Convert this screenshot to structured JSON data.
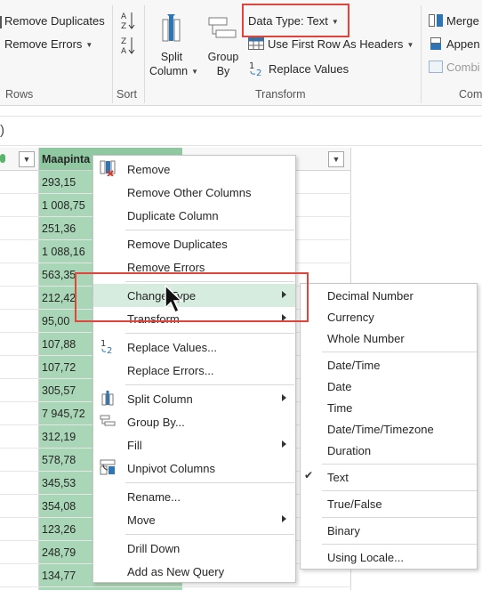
{
  "ribbon": {
    "remove_duplicates": "Remove Duplicates",
    "remove_errors": "Remove Errors",
    "rows_label": "Rows",
    "sort_label": "Sort",
    "split_column": [
      "Split",
      "Column"
    ],
    "group_by": [
      "Group",
      "By"
    ],
    "data_type": "Data Type: Text",
    "use_first_row": "Use First Row As Headers",
    "replace_values": "Replace Values",
    "transform_label": "Transform",
    "merge": "Merge",
    "append": "Appen",
    "combine": "Combi",
    "combine_label": "Com"
  },
  "formula": {
    "paren": ")"
  },
  "table": {
    "column_header": "Maapinta",
    "values": [
      "293,15",
      "1 008,75",
      "251,36",
      "1 088,16",
      "563,35",
      "212,42",
      "95,00",
      "107,88",
      "107,72",
      "305,57",
      "7 945,72",
      "312,19",
      "578,78",
      "345,53",
      "354,08",
      "123,26",
      "248,79",
      "134,77"
    ]
  },
  "context_menu": {
    "items": [
      {
        "label": "Remove",
        "icon": "remove-column-icon"
      },
      {
        "label": "Remove Other Columns"
      },
      {
        "label": "Duplicate Column"
      },
      {
        "label": "Remove Duplicates"
      },
      {
        "label": "Remove Errors"
      },
      {
        "label": "Change Type",
        "submenu": true
      },
      {
        "label": "Transform",
        "submenu": true
      },
      {
        "label": "Replace Values...",
        "icon": "replace-values-icon"
      },
      {
        "label": "Replace Errors..."
      },
      {
        "label": "Split Column",
        "icon": "split-column-icon",
        "submenu": true
      },
      {
        "label": "Group By...",
        "icon": "group-by-icon"
      },
      {
        "label": "Fill",
        "submenu": true
      },
      {
        "label": "Unpivot Columns",
        "icon": "unpivot-icon"
      },
      {
        "label": "Rename..."
      },
      {
        "label": "Move",
        "submenu": true
      },
      {
        "label": "Drill Down"
      },
      {
        "label": "Add as New Query"
      }
    ]
  },
  "type_submenu": {
    "items": [
      "Decimal Number",
      "Currency",
      "Whole Number",
      "Date/Time",
      "Date",
      "Time",
      "Date/Time/Timezone",
      "Duration",
      "Text",
      "True/False",
      "Binary",
      "Using Locale..."
    ],
    "checked": "Text"
  },
  "colors": {
    "highlight_box": "#e0443a",
    "selected_column": "#a9d6b6",
    "menu_hover": "#d5ecde"
  }
}
